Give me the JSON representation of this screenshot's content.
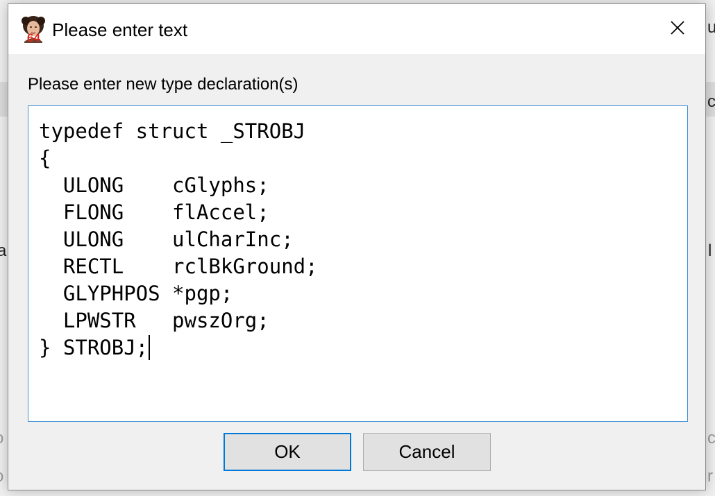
{
  "background": {
    "fragments": [
      "u",
      "c",
      "a",
      "l",
      "o",
      "c",
      "o",
      "r"
    ]
  },
  "dialog": {
    "title": "Please enter text",
    "app_icon": "ida-portrait-64-icon",
    "close_icon": "close-icon",
    "prompt": "Please enter new type declaration(s)",
    "editor_lines": [
      "typedef struct _STROBJ",
      "{",
      "  ULONG    cGlyphs;",
      "  FLONG    flAccel;",
      "  ULONG    ulCharInc;",
      "  RECTL    rclBkGround;",
      "  GLYPHPOS *pgp;",
      "  LPWSTR   pwszOrg;",
      "} STROBJ;"
    ],
    "ok_label": "OK",
    "cancel_label": "Cancel"
  },
  "colors": {
    "accent": "#0078d7",
    "editor_border": "#3c8fd6",
    "dialog_bg": "#f0f0f0"
  }
}
